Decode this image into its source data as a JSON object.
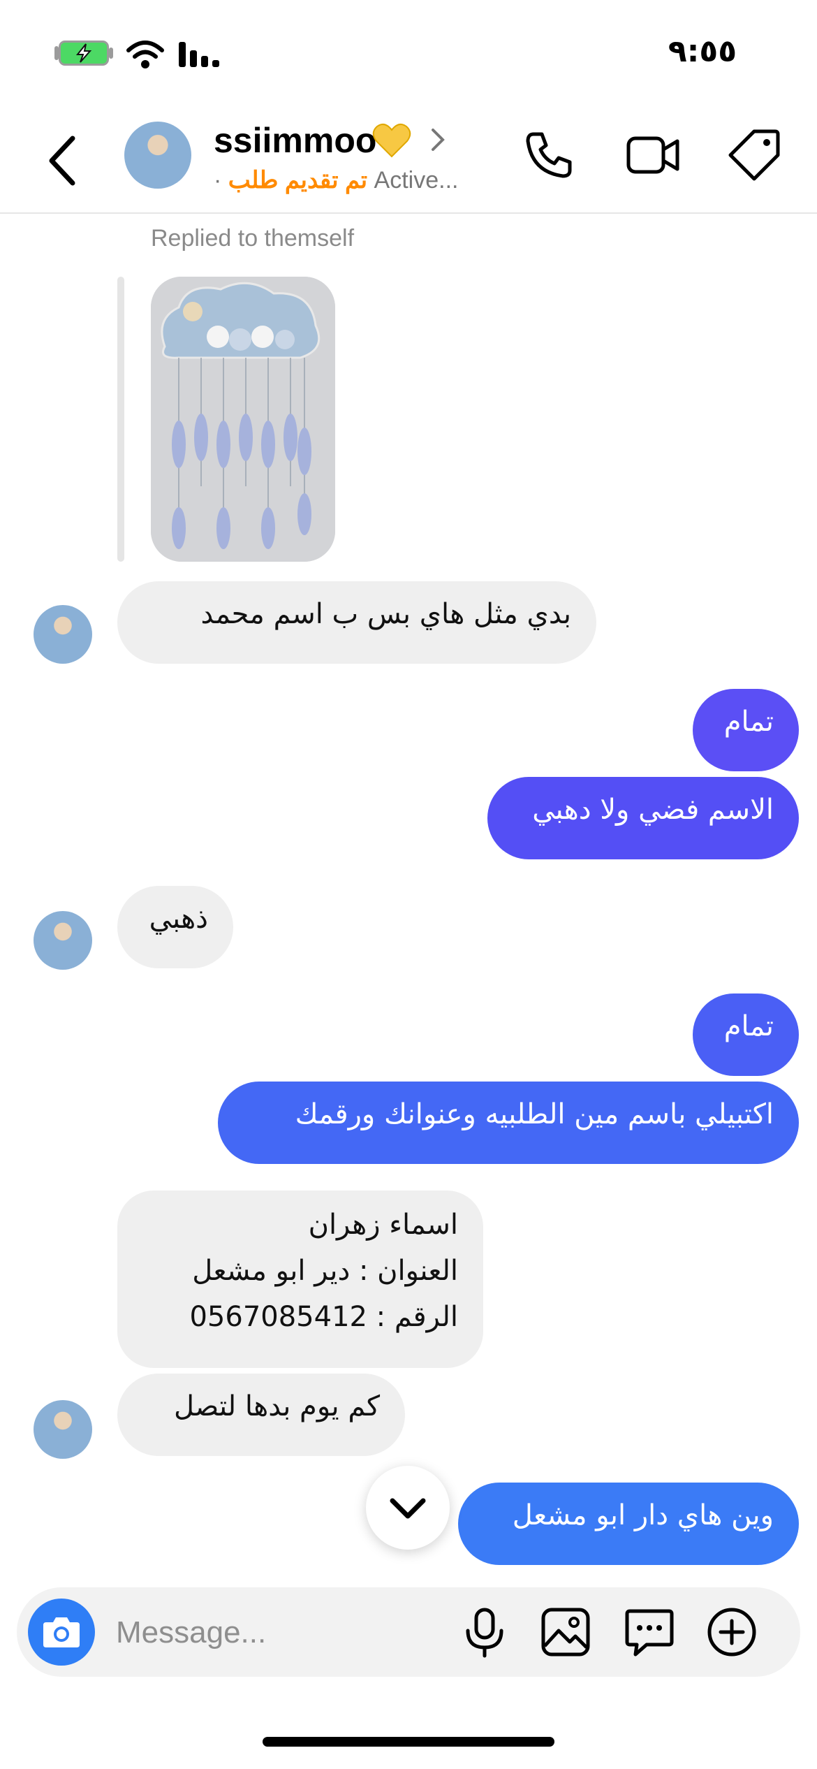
{
  "status_bar": {
    "time": "٩:٥٥"
  },
  "header": {
    "username": "ssiimmoo",
    "subtitle_order": "تم تقديم طلب",
    "subtitle_separator": " · ",
    "subtitle_active": "Active..."
  },
  "thread": {
    "replied_label": "Replied to themself",
    "messages": [
      {
        "text": "بدي مثل هاي بس ب  اسم محمد"
      },
      {
        "text": "تمام"
      },
      {
        "text": "الاسم فضي ولا دهبي"
      },
      {
        "text": "ذهبي"
      },
      {
        "text": "تمام"
      },
      {
        "text": "اكتبيلي باسم مين الطلبيه وعنوانك ورقمك"
      },
      {
        "lines": [
          "اسماء زهران",
          "العنوان : دير ابو مشعل",
          "الرقم  : 0567085412"
        ]
      },
      {
        "text": "كم يوم بدها لتصل"
      },
      {
        "text": "وين هاي دار ابو مشعل"
      }
    ]
  },
  "composer": {
    "placeholder": "Message..."
  },
  "colors": {
    "accent_orange": "#ff8a00",
    "bubble_in": "#efefef",
    "bubble_out_purple": "#5b4ff5",
    "bubble_out_indigo": "#4a5ff5",
    "bubble_out_blue": "#3b7bf6",
    "camera_blue": "#2f7ef6"
  }
}
